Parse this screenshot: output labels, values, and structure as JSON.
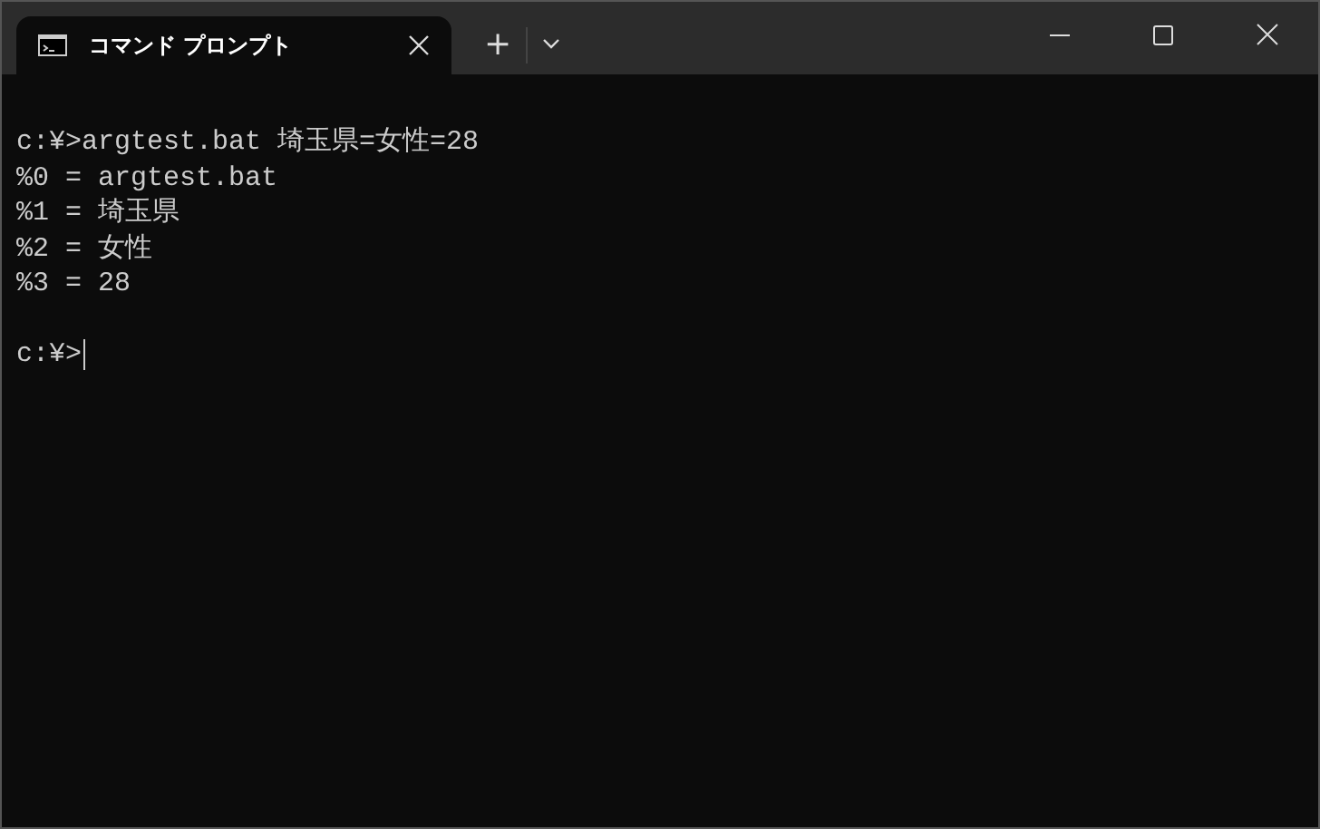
{
  "tabs": [
    {
      "title": "コマンド プロンプト",
      "selected": true
    }
  ],
  "new_tab_button": "+",
  "terminal": {
    "lines": [
      "c:¥>argtest.bat 埼玉県=女性=28",
      "%0 = argtest.bat",
      "%1 = 埼玉県",
      "%2 = 女性",
      "%3 = 28"
    ],
    "prompt": {
      "text": "c:¥>",
      "cursor": true
    }
  }
}
